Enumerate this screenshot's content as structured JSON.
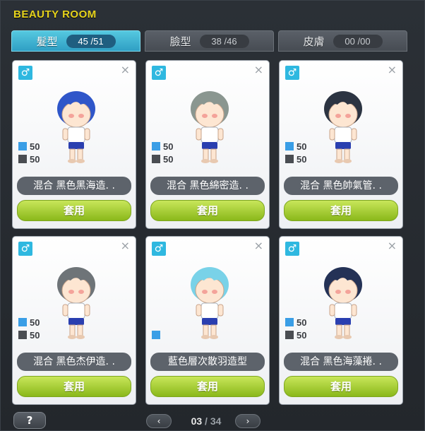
{
  "window": {
    "title": "BEAUTY ROOM"
  },
  "tabs": [
    {
      "label": "髮型",
      "count": "45 /51",
      "active": true
    },
    {
      "label": "臉型",
      "count": "38 /46",
      "active": false
    },
    {
      "label": "皮膚",
      "count": "00 /00",
      "active": false
    }
  ],
  "cards": [
    {
      "gender": "♂",
      "close": "×",
      "color1_pct": "50",
      "color2_pct": "50",
      "name": "混合  黑色黑海造. .",
      "apply_label": "套用"
    },
    {
      "gender": "♂",
      "close": "×",
      "color1_pct": "50",
      "color2_pct": "50",
      "name": "混合  黑色綿密造. .",
      "apply_label": "套用"
    },
    {
      "gender": "♂",
      "close": "×",
      "color1_pct": "50",
      "color2_pct": "50",
      "name": "混合  黑色帥氣管. .",
      "apply_label": "套用"
    },
    {
      "gender": "♂",
      "close": "×",
      "color1_pct": "50",
      "color2_pct": "50",
      "name": "混合  黑色杰伊造. .",
      "apply_label": "套用"
    },
    {
      "gender": "♂",
      "close": "×",
      "color1_pct": "",
      "color2_pct": "",
      "name": "藍色層次散羽造型",
      "apply_label": "套用"
    },
    {
      "gender": "♂",
      "close": "×",
      "color1_pct": "50",
      "color2_pct": "50",
      "name": "混合  黑色海藻捲. .",
      "apply_label": "套用"
    }
  ],
  "pagination": {
    "current": "03",
    "separator": "/",
    "total": "34",
    "prev": "‹",
    "next": "›"
  },
  "help": {
    "label": "?"
  },
  "colors": {
    "title": "#e6d31c",
    "tab_active": "#2f9fc4",
    "apply_button": "#9bc42a",
    "swatch_primary": "#3a9ee6",
    "swatch_secondary": "#4a4d52",
    "hair": [
      "#2f56c9",
      "#8a9690",
      "#2c3442",
      "#6e7478",
      "#79d2e8",
      "#243256"
    ]
  }
}
